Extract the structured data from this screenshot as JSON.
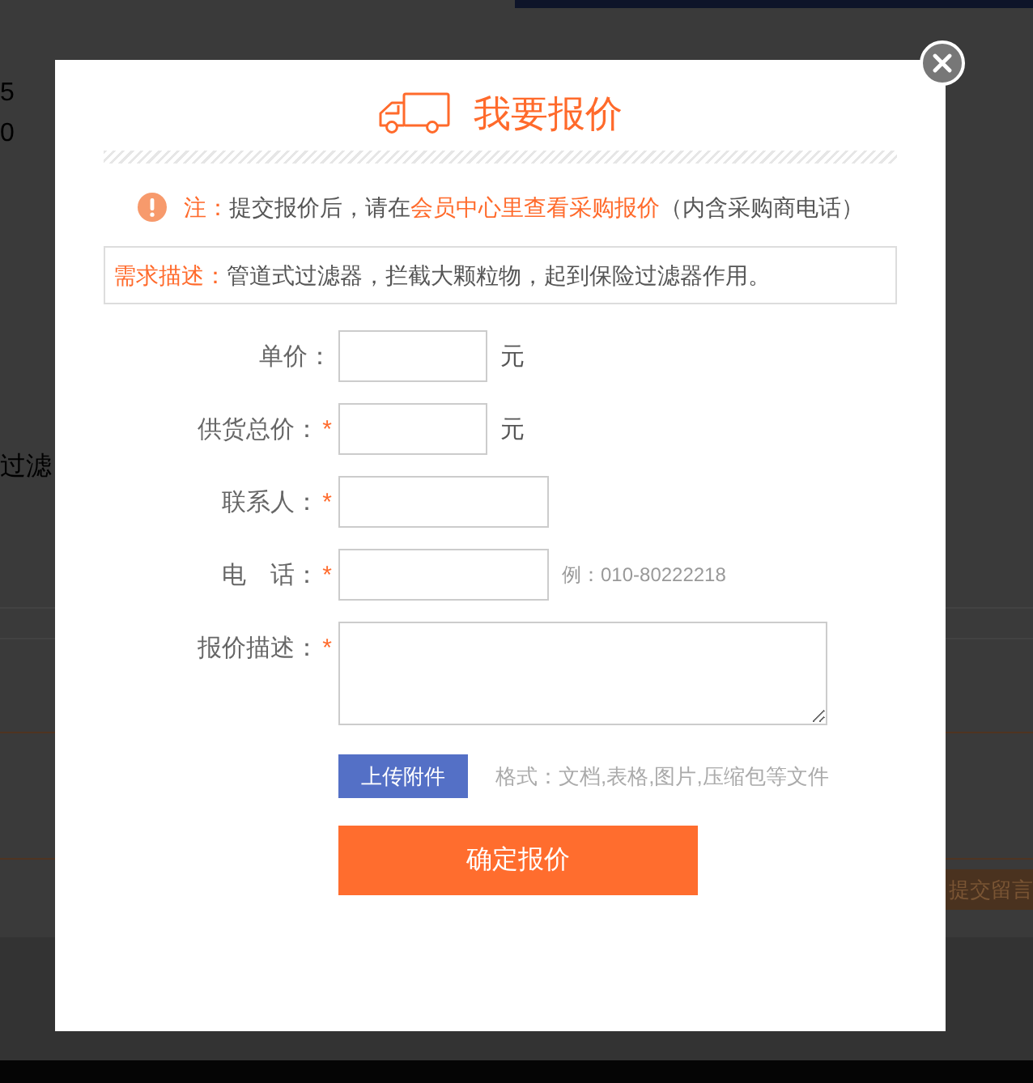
{
  "background_page": {
    "left_texts": [
      "5",
      "0",
      "过滤"
    ],
    "right_button": "提交留言"
  },
  "dialog": {
    "title": "我要报价",
    "note": [
      {
        "text": "注：",
        "highlight": true
      },
      {
        "text": "提交报价后，请在",
        "highlight": false
      },
      {
        "text": "会员中心里查看采购报价",
        "highlight": true
      },
      {
        "text": "（内含采购商电话）",
        "highlight": false
      }
    ],
    "requirement": {
      "label": "需求描述：",
      "text": "管道式过滤器，拦截大颗粒物，起到保险过滤器作用。"
    },
    "form": {
      "required_mark": "*",
      "rows": [
        {
          "kind": "amount",
          "label": "单价：",
          "required": false,
          "unit": "元"
        },
        {
          "kind": "amount",
          "label": "供货总价：",
          "required": true,
          "unit": "元"
        },
        {
          "kind": "text",
          "label": "联系人：",
          "required": true
        },
        {
          "kind": "text",
          "label": "电　话：",
          "required": true,
          "hint": "例：010-80222218"
        },
        {
          "kind": "textarea",
          "label": "报价描述：",
          "required": true
        }
      ]
    },
    "upload": {
      "button": "上传附件",
      "hint": "格式：文档,表格,图片,压缩包等文件"
    },
    "submit": "确定报价"
  }
}
